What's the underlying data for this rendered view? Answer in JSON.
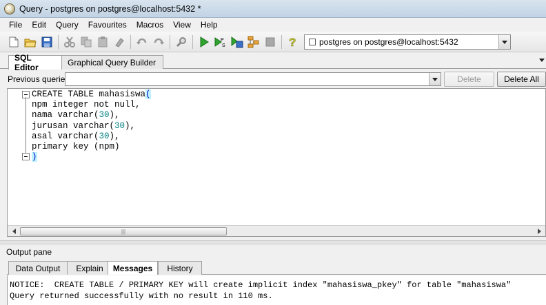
{
  "window": {
    "title": "Query - postgres on postgres@localhost:5432 *"
  },
  "menu": [
    "File",
    "Edit",
    "Query",
    "Favourites",
    "Macros",
    "View",
    "Help"
  ],
  "toolbar": {
    "icons": [
      "new-file-icon",
      "open-folder-icon",
      "save-icon",
      "cut-icon",
      "copy-icon",
      "paste-icon",
      "clear-icon",
      "undo-icon",
      "redo-icon",
      "find-icon",
      "execute-icon",
      "execute-pgscript-icon",
      "execute-to-file-icon",
      "explain-icon",
      "stop-icon",
      "help-icon"
    ],
    "connection": "postgres on postgres@localhost:5432"
  },
  "editor_tabs": [
    "SQL Editor",
    "Graphical Query Builder"
  ],
  "previous_queries": {
    "label": "Previous queries",
    "value": "",
    "delete_label": "Delete",
    "delete_all_label": "Delete All"
  },
  "sql": {
    "line1": "CREATE TABLE mahasiswa",
    "line2": "npm integer not null,",
    "line3_a": "nama varchar(",
    "line3_n": "30",
    "line3_b": "),",
    "line4_a": "jurusan varchar(",
    "line4_n": "30",
    "line4_b": "),",
    "line5_a": "asal varchar(",
    "line5_n": "30",
    "line5_b": "),",
    "line6": "primary key (npm)",
    "open_paren": "(",
    "close_paren": ")"
  },
  "scrollbar": {
    "thumb_grip": "|||"
  },
  "output": {
    "label": "Output pane",
    "tabs": [
      "Data Output",
      "Explain",
      "Messages",
      "History"
    ],
    "messages": [
      "NOTICE:  CREATE TABLE / PRIMARY KEY will create implicit index \"mahasiswa_pkey\" for table \"mahasiswa\"",
      "Query returned successfully with no result in 110 ms."
    ]
  }
}
